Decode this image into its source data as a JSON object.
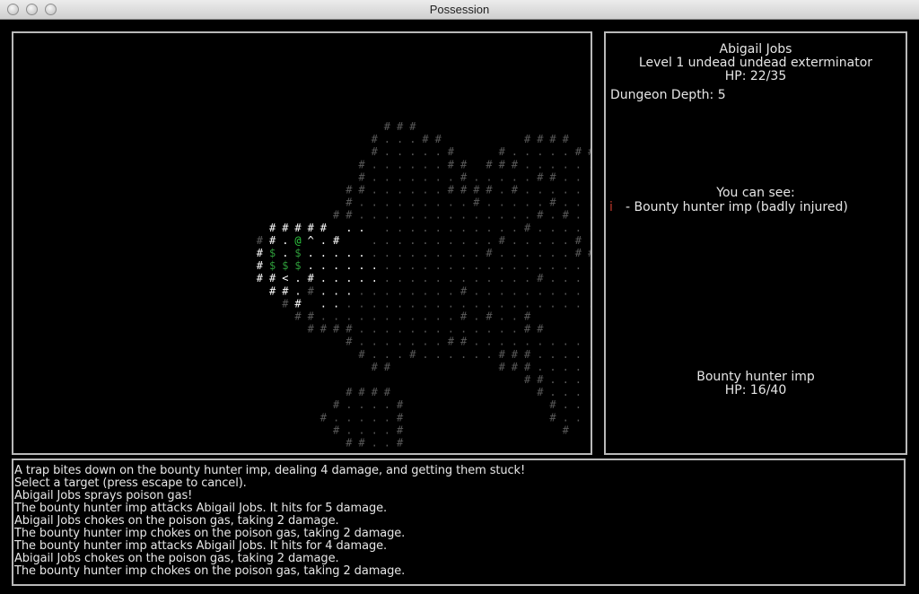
{
  "window": {
    "title": "Possession"
  },
  "player": {
    "name": "Abigail Jobs",
    "description": "Level 1 undead undead exterminator",
    "hp": "HP: 22/35"
  },
  "dungeon_depth": "Dungeon Depth: 5",
  "you_can_see": {
    "title": "You can see:",
    "items": [
      {
        "glyph": "i",
        "glyph_color": "#c0392b",
        "label": "- Bounty hunter imp (badly injured)"
      }
    ]
  },
  "target": {
    "name": "Bounty hunter imp",
    "hp": "HP: 16/40"
  },
  "log": [
    "A trap bites down on the bounty hunter imp, dealing 4 damage, and getting them stuck!",
    "Select a target (press escape to cancel).",
    "Abigail Jobs sprays poison gas!",
    "The bounty hunter imp attacks Abigail Jobs. It hits for 5 damage.",
    "Abigail Jobs chokes on the poison gas, taking 2 damage.",
    "The bounty hunter imp chokes on the poison gas, taking 2 damage.",
    "The bounty hunter imp attacks Abigail Jobs. It hits for 4 damage.",
    "Abigail Jobs chokes on the poison gas, taking 2 damage.",
    "The bounty hunter imp chokes on the poison gas, taking 2 damage."
  ],
  "map": {
    "colors": {
      "lit": "#ffffff",
      "remembered": "#5a5a5a",
      "gas": "#2e9c3a",
      "player": "#2ecc40"
    },
    "tiles": [
      {
        "r": 0,
        "c": 29,
        "ch": "###",
        "k": "remembered"
      },
      {
        "r": 1,
        "c": 28,
        "ch": "#...##",
        "k": "remembered"
      },
      {
        "r": 1,
        "c": 40,
        "ch": "####",
        "k": "remembered"
      },
      {
        "r": 2,
        "c": 28,
        "ch": "#.....#",
        "k": "remembered"
      },
      {
        "r": 2,
        "c": 38,
        "ch": "#.....###",
        "k": "remembered"
      },
      {
        "r": 3,
        "c": 27,
        "ch": "#......##",
        "k": "remembered"
      },
      {
        "r": 3,
        "c": 37,
        "ch": "###.......",
        "k": "remembered"
      },
      {
        "r": 4,
        "c": 27,
        "ch": "#.......#.....##.......",
        "k": "remembered"
      },
      {
        "r": 5,
        "c": 26,
        "ch": "##......####.#.........",
        "k": "remembered"
      },
      {
        "r": 6,
        "c": 26,
        "ch": "#.........#.....#...###",
        "k": "remembered"
      },
      {
        "r": 7,
        "c": 25,
        "ch": "##..............#.#..##",
        "k": "remembered"
      },
      {
        "r": 8,
        "c": 20,
        "ch": "#####",
        "k": "lit"
      },
      {
        "r": 8,
        "c": 26,
        "ch": "..",
        "k": "lit"
      },
      {
        "r": 8,
        "c": 29,
        "ch": "...........#.......",
        "k": "remembered"
      },
      {
        "r": 9,
        "c": 19,
        "ch": "#",
        "k": "remembered"
      },
      {
        "r": 9,
        "c": 20,
        "ch": "#.",
        "k": "lit"
      },
      {
        "r": 9,
        "c": 22,
        "ch": "@",
        "k": "player"
      },
      {
        "r": 9,
        "c": 23,
        "ch": "^.#",
        "k": "lit"
      },
      {
        "r": 9,
        "c": 28,
        "ch": "..........#.....#...",
        "k": "remembered"
      },
      {
        "r": 10,
        "c": 19,
        "ch": "#",
        "k": "lit"
      },
      {
        "r": 10,
        "c": 20,
        "ch": "$",
        "k": "gas"
      },
      {
        "r": 10,
        "c": 21,
        "ch": ".",
        "k": "lit"
      },
      {
        "r": 10,
        "c": 22,
        "ch": "$",
        "k": "gas"
      },
      {
        "r": 10,
        "c": 23,
        "ch": ".....",
        "k": "lit"
      },
      {
        "r": 10,
        "c": 28,
        "ch": ".........#......##",
        "k": "remembered"
      },
      {
        "r": 11,
        "c": 19,
        "ch": "#",
        "k": "lit"
      },
      {
        "r": 11,
        "c": 20,
        "ch": "$",
        "k": "gas"
      },
      {
        "r": 11,
        "c": 21,
        "ch": "$",
        "k": "gas"
      },
      {
        "r": 11,
        "c": 22,
        "ch": "$",
        "k": "gas"
      },
      {
        "r": 11,
        "c": 23,
        "ch": "......",
        "k": "lit"
      },
      {
        "r": 11,
        "c": 29,
        "ch": "..................",
        "k": "remembered"
      },
      {
        "r": 12,
        "c": 19,
        "ch": "##<.#.....",
        "k": "lit"
      },
      {
        "r": 12,
        "c": 29,
        "ch": "............#.....",
        "k": "remembered"
      },
      {
        "r": 13,
        "c": 20,
        "ch": "##.",
        "k": "lit"
      },
      {
        "r": 13,
        "c": 23,
        "ch": "#",
        "k": "remembered"
      },
      {
        "r": 13,
        "c": 24,
        "ch": "...",
        "k": "lit"
      },
      {
        "r": 13,
        "c": 27,
        "ch": "........#.........",
        "k": "remembered"
      },
      {
        "r": 14,
        "c": 21,
        "ch": "#",
        "k": "remembered"
      },
      {
        "r": 14,
        "c": 22,
        "ch": "#",
        "k": "lit"
      },
      {
        "r": 14,
        "c": 24,
        "ch": "..",
        "k": "lit"
      },
      {
        "r": 14,
        "c": 26,
        "ch": "....................",
        "k": "remembered"
      },
      {
        "r": 15,
        "c": 22,
        "ch": "##...........#.#..#",
        "k": "remembered"
      },
      {
        "r": 16,
        "c": 23,
        "ch": "####.............##",
        "k": "remembered"
      },
      {
        "r": 17,
        "c": 26,
        "ch": "#.......##.........",
        "k": "remembered"
      },
      {
        "r": 18,
        "c": 27,
        "ch": "#...#......###......",
        "k": "remembered"
      },
      {
        "r": 19,
        "c": 28,
        "ch": "##",
        "k": "remembered"
      },
      {
        "r": 19,
        "c": 38,
        "ch": "###......",
        "k": "remembered"
      },
      {
        "r": 20,
        "c": 40,
        "ch": "##....",
        "k": "remembered"
      },
      {
        "r": 21,
        "c": 26,
        "ch": "####",
        "k": "remembered"
      },
      {
        "r": 21,
        "c": 41,
        "ch": "#....",
        "k": "remembered"
      },
      {
        "r": 22,
        "c": 25,
        "ch": "#....#",
        "k": "remembered"
      },
      {
        "r": 22,
        "c": 42,
        "ch": "#..",
        "k": "remembered"
      },
      {
        "r": 23,
        "c": 24,
        "ch": "#.....#",
        "k": "remembered"
      },
      {
        "r": 23,
        "c": 42,
        "ch": "#..",
        "k": "remembered"
      },
      {
        "r": 24,
        "c": 25,
        "ch": "#....#",
        "k": "remembered"
      },
      {
        "r": 24,
        "c": 43,
        "ch": "#",
        "k": "remembered"
      },
      {
        "r": 25,
        "c": 26,
        "ch": "##..#",
        "k": "remembered"
      }
    ]
  }
}
